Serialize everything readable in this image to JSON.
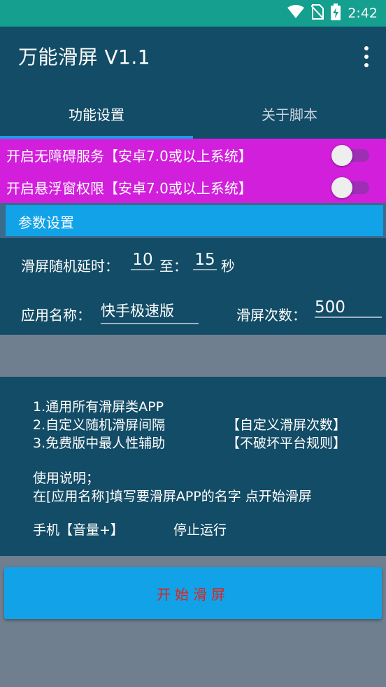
{
  "status_bar": {
    "time": "2:42",
    "icons": [
      "wifi-icon",
      "no-sim-icon",
      "battery-charging-icon"
    ]
  },
  "app_bar": {
    "title": "万能滑屏 V1.1",
    "menu_icon": "more-vert-icon"
  },
  "tabs": [
    {
      "label": "功能设置",
      "active": true
    },
    {
      "label": "关于脚本",
      "active": false
    }
  ],
  "switches": [
    {
      "label": "开启无障碍服务【安卓7.0或以上系统】",
      "on": false
    },
    {
      "label": "开启悬浮窗权限【安卓7.0或以上系统】",
      "on": false
    }
  ],
  "params": {
    "header": "参数设置",
    "delay_label": "滑屏随机延时：",
    "delay_min": "10",
    "to_label": "至：",
    "delay_max": "15",
    "unit_label": "秒",
    "app_name_label": "应用名称：",
    "app_name_value": "快手极速版",
    "count_label": "滑屏次数：",
    "count_value": "500"
  },
  "info": {
    "line1": "1.通用所有滑屏类APP",
    "line2_left": "2.自定义随机滑屏间隔",
    "line2_right": "【自定义滑屏次数】",
    "line3_left": "3.免费版中最人性辅助",
    "line3_right": "【不破坏平台规则】",
    "usage_title": "使用说明；",
    "usage_text": "在[应用名称]填写要滑屏APP的名字 点开始滑屏",
    "stop_key": "手机【音量+】",
    "stop_text": "停止运行"
  },
  "start_button": {
    "label": "开始滑屏"
  },
  "colors": {
    "status_bar": "#159f8e",
    "primary_dark": "#134c66",
    "accent_blue": "#11a2e8",
    "switch_bg": "#d21fdc",
    "background": "#6f7f8f",
    "start_text": "#e0241c"
  }
}
